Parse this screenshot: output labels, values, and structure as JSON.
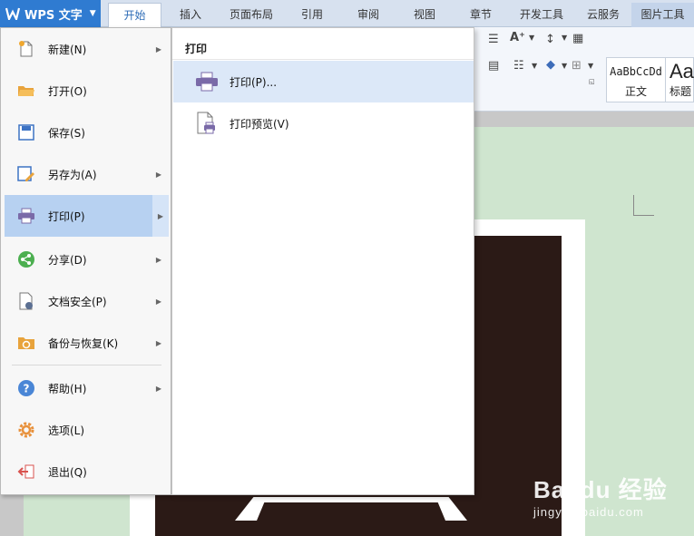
{
  "app": {
    "menu_button": "WPS 文字"
  },
  "tabs": [
    {
      "label": "开始",
      "active": true
    },
    {
      "label": "插入"
    },
    {
      "label": "页面布局"
    },
    {
      "label": "引用"
    },
    {
      "label": "审阅"
    },
    {
      "label": "视图"
    },
    {
      "label": "章节"
    },
    {
      "label": "开发工具"
    },
    {
      "label": "云服务"
    },
    {
      "label": "图片工具"
    }
  ],
  "ribbon": {
    "styles": [
      {
        "sample": "AaBbCcDd",
        "name": "正文"
      },
      {
        "sample": "Aa",
        "name": "标题"
      }
    ]
  },
  "file_menu": {
    "items": [
      {
        "label": "新建(N)",
        "icon": "new-document-icon",
        "has_submenu": true
      },
      {
        "label": "打开(O)",
        "icon": "folder-open-icon",
        "has_submenu": false
      },
      {
        "label": "保存(S)",
        "icon": "save-icon",
        "has_submenu": false
      },
      {
        "label": "另存为(A)",
        "icon": "save-as-icon",
        "has_submenu": true
      },
      {
        "label": "打印(P)",
        "icon": "printer-icon",
        "has_submenu": true,
        "selected": true
      },
      {
        "label": "分享(D)",
        "icon": "share-icon",
        "has_submenu": true
      },
      {
        "label": "文档安全(P)",
        "icon": "document-security-icon",
        "has_submenu": true
      },
      {
        "label": "备份与恢复(K)",
        "icon": "backup-restore-icon",
        "has_submenu": true
      },
      {
        "label": "帮助(H)",
        "icon": "help-icon",
        "has_submenu": true
      },
      {
        "label": "选项(L)",
        "icon": "gear-icon",
        "has_submenu": false
      },
      {
        "label": "退出(Q)",
        "icon": "exit-icon",
        "has_submenu": false
      }
    ]
  },
  "print_submenu": {
    "title": "打印",
    "items": [
      {
        "label": "打印(P)...",
        "icon": "printer-icon",
        "highlighted": true
      },
      {
        "label": "打印预览(V)",
        "icon": "print-preview-icon"
      }
    ]
  },
  "watermark": {
    "main": "Bai du 经验",
    "sub": "jingyan.baidu.com"
  },
  "colors": {
    "accent": "#2f7bd1",
    "menu_highlight": "#b7d1f1",
    "submenu_highlight": "#dce8f8",
    "doc_background": "#cfe5cf",
    "image_dark": "#2b1a16"
  }
}
